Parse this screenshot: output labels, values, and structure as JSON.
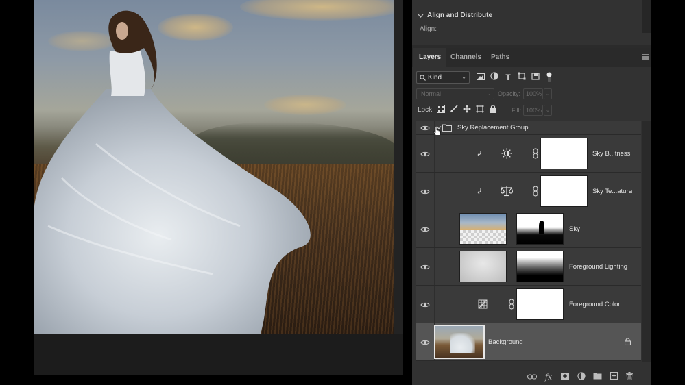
{
  "align_panel": {
    "title": "Align and Distribute",
    "align_label": "Align:"
  },
  "layers_panel": {
    "tabs": [
      "Layers",
      "Channels",
      "Paths"
    ],
    "active_tab": "Layers",
    "filter": {
      "kind_value": "Kind",
      "icons": [
        "image-filter-icon",
        "adjustment-filter-icon",
        "type-filter-icon",
        "shape-filter-icon",
        "smart-object-filter-icon",
        "filter-toggle-icon"
      ]
    },
    "blend_mode": "Normal",
    "opacity_label": "Opacity:",
    "opacity_value": "100%",
    "lock_label": "Lock:",
    "lock_icons": [
      "lock-transparent-icon",
      "lock-image-icon",
      "lock-position-icon",
      "lock-artboard-icon",
      "lock-all-icon"
    ],
    "fill_label": "Fill:",
    "fill_value": "100%",
    "layers": [
      {
        "name": "Sky Replacement Group",
        "type": "group",
        "visible": true
      },
      {
        "name": "Sky B...tness",
        "type": "adjustment",
        "icon": "brightness-icon",
        "visible": true
      },
      {
        "name": "Sky Te...ature",
        "type": "adjustment",
        "icon": "color-balance-icon",
        "visible": true
      },
      {
        "name": "Sky",
        "type": "pixel",
        "visible": true
      },
      {
        "name": "Foreground Lighting",
        "type": "pixel",
        "visible": true
      },
      {
        "name": "Foreground Color",
        "type": "fill",
        "visible": true
      },
      {
        "name": "Background",
        "type": "background",
        "visible": true,
        "locked": true,
        "selected": true
      }
    ],
    "footer_icons": [
      "link-layers-icon",
      "fx-icon",
      "add-mask-icon",
      "new-adjustment-icon",
      "new-group-icon",
      "new-layer-icon",
      "delete-layer-icon"
    ]
  },
  "colors": {
    "panel_bg": "#323232",
    "selected_row": "#555555",
    "canvas_bg": "#1e1e1e"
  }
}
